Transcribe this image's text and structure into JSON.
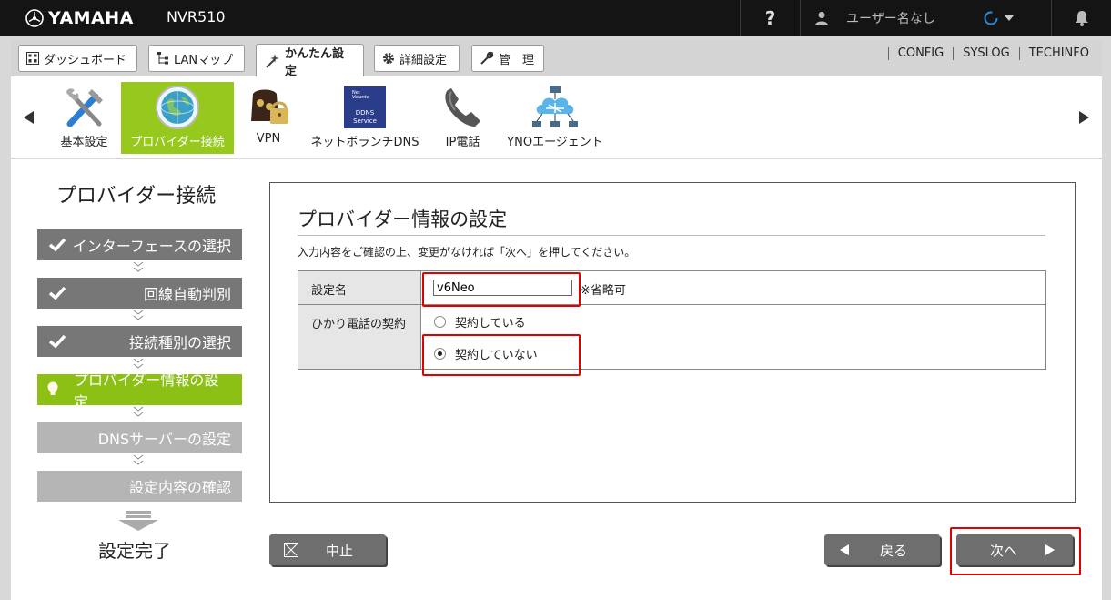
{
  "header": {
    "brand": "YAMAHA",
    "device": "NVR510",
    "help": "?",
    "user": "ユーザー名なし"
  },
  "tabs": [
    {
      "label": "ダッシュボード"
    },
    {
      "label": "LANマップ"
    },
    {
      "label": "かんたん設定"
    },
    {
      "label": "詳細設定"
    },
    {
      "label": "管　理"
    }
  ],
  "toplinks": [
    "CONFIG",
    "SYSLOG",
    "TECHINFO"
  ],
  "quick_items": [
    "基本設定",
    "プロバイダー接続",
    "VPN",
    "ネットボランチDNS",
    "IP電話",
    "YNOエージェント"
  ],
  "ddns_icon_text": {
    "line1": "Net",
    "line2": "Volante",
    "line3": "DDNS",
    "line4": "Service"
  },
  "sidebar": {
    "title": "プロバイダー接続",
    "steps": [
      "インターフェースの選択",
      "回線自動判別",
      "接続種別の選択",
      "プロバイダー情報の設定",
      "DNSサーバーの設定",
      "設定内容の確認"
    ],
    "done": "設定完了"
  },
  "form": {
    "title": "プロバイダー情報の設定",
    "description": "入力内容をご確認の上、変更がなければ「次へ」を押してください。",
    "name_label": "設定名",
    "name_value": "v6Neo",
    "name_note": "※省略可",
    "contract_label": "ひかり電話の契約",
    "contract_yes": "契約している",
    "contract_no": "契約していない",
    "contract_selected": "no"
  },
  "buttons": {
    "cancel": "中止",
    "back": "戻る",
    "next": "次へ"
  },
  "colors": {
    "accent_green": "#96c81e",
    "highlight_red": "#e00000",
    "topbar": "#141414"
  }
}
